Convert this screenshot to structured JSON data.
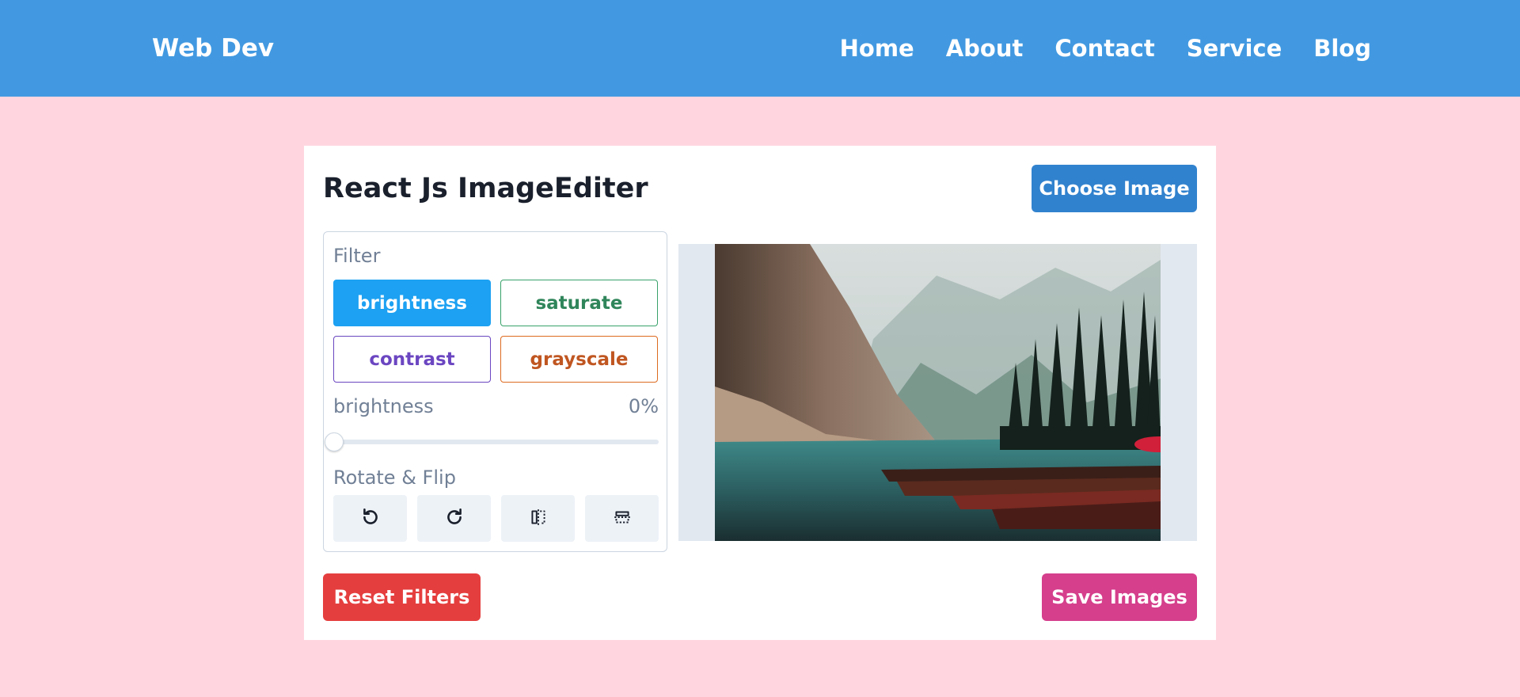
{
  "nav": {
    "brand": "Web Dev",
    "links": [
      "Home",
      "About",
      "Contact",
      "Service",
      "Blog"
    ]
  },
  "editor": {
    "title": "React Js ImageEditer",
    "choose_label": "Choose Image",
    "filter_label": "Filter",
    "filters": [
      "brightness",
      "saturate",
      "contrast",
      "grayscale"
    ],
    "active_filter": "brightness",
    "slider": {
      "name": "brightness",
      "value_text": "0%",
      "value_fraction": 0.0
    },
    "rotate_label": "Rotate & Flip",
    "rotate_icons": [
      "rotate-left-icon",
      "rotate-right-icon",
      "flip-horizontal-icon",
      "flip-vertical-icon"
    ],
    "reset_label": "Reset Filters",
    "save_label": "Save Images"
  },
  "colors": {
    "navbar": "#4299e1",
    "page_bg": "#ffd6e0",
    "choose": "#3182ce",
    "reset": "#e53e3e",
    "save": "#d53f8c",
    "active_filter": "#1da1f2"
  }
}
